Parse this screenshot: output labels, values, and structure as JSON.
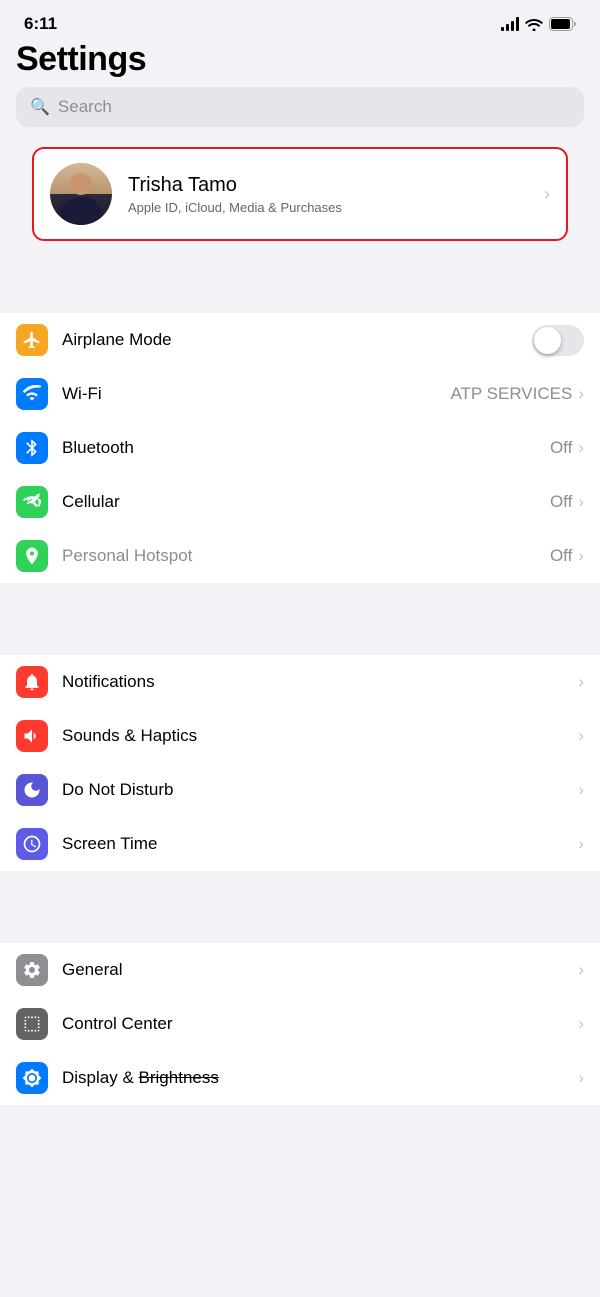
{
  "statusBar": {
    "time": "6:11"
  },
  "header": {
    "title": "Settings"
  },
  "search": {
    "placeholder": "Search"
  },
  "profile": {
    "name": "Trisha Tamo",
    "subtitle": "Apple ID, iCloud, Media & Purchases"
  },
  "connectivity": {
    "airplaneMode": {
      "label": "Airplane Mode",
      "iconBg": "#f5a623",
      "value": ""
    },
    "wifi": {
      "label": "Wi-Fi",
      "iconBg": "#007aff",
      "value": "ATP SERVICES"
    },
    "bluetooth": {
      "label": "Bluetooth",
      "iconBg": "#007aff",
      "value": "Off"
    },
    "cellular": {
      "label": "Cellular",
      "iconBg": "#30d158",
      "value": "Off"
    },
    "hotspot": {
      "label": "Personal Hotspot",
      "iconBg": "#30d158",
      "value": "Off"
    }
  },
  "notifications": {
    "notifications": {
      "label": "Notifications",
      "iconBg": "#ff3b30"
    },
    "sounds": {
      "label": "Sounds & Haptics",
      "iconBg": "#ff3b30"
    },
    "doNotDisturb": {
      "label": "Do Not Disturb",
      "iconBg": "#5856d6"
    },
    "screenTime": {
      "label": "Screen Time",
      "iconBg": "#5e5ce6"
    }
  },
  "system": {
    "general": {
      "label": "General",
      "iconBg": "#8e8e93"
    },
    "controlCenter": {
      "label": "Control Center",
      "iconBg": "#636366"
    },
    "display": {
      "label": "Display & Brightness",
      "iconBg": "#007aff"
    }
  }
}
